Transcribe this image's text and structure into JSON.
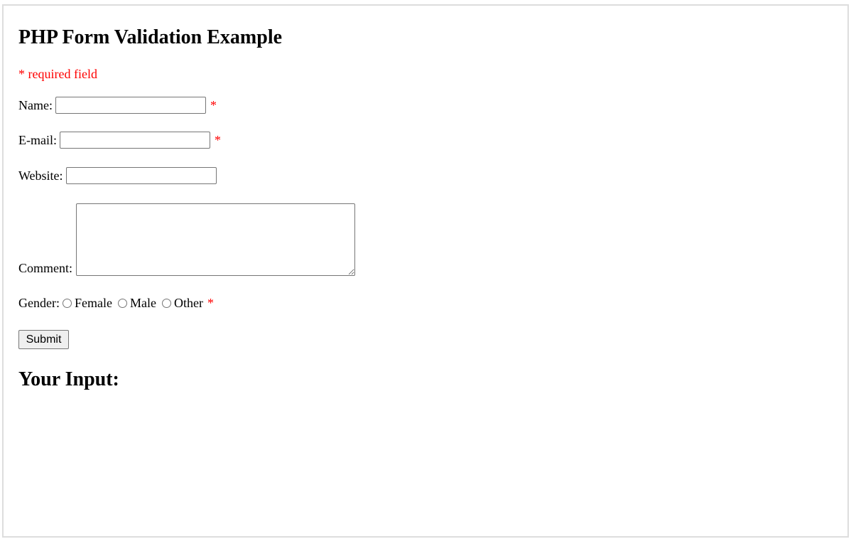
{
  "form": {
    "title": "PHP Form Validation Example",
    "required_note": "* required field",
    "required_marker": "*",
    "name_label": "Name:",
    "name_value": "",
    "email_label": "E-mail:",
    "email_value": "",
    "website_label": "Website:",
    "website_value": "",
    "comment_label": "Comment:",
    "comment_value": "",
    "gender_label": "Gender:",
    "gender_options": [
      "Female",
      "Male",
      "Other"
    ],
    "submit_label": "Submit"
  },
  "output": {
    "heading": "Your Input:"
  },
  "colors": {
    "required": "#ff0000",
    "frame_border": "#dddddd"
  }
}
